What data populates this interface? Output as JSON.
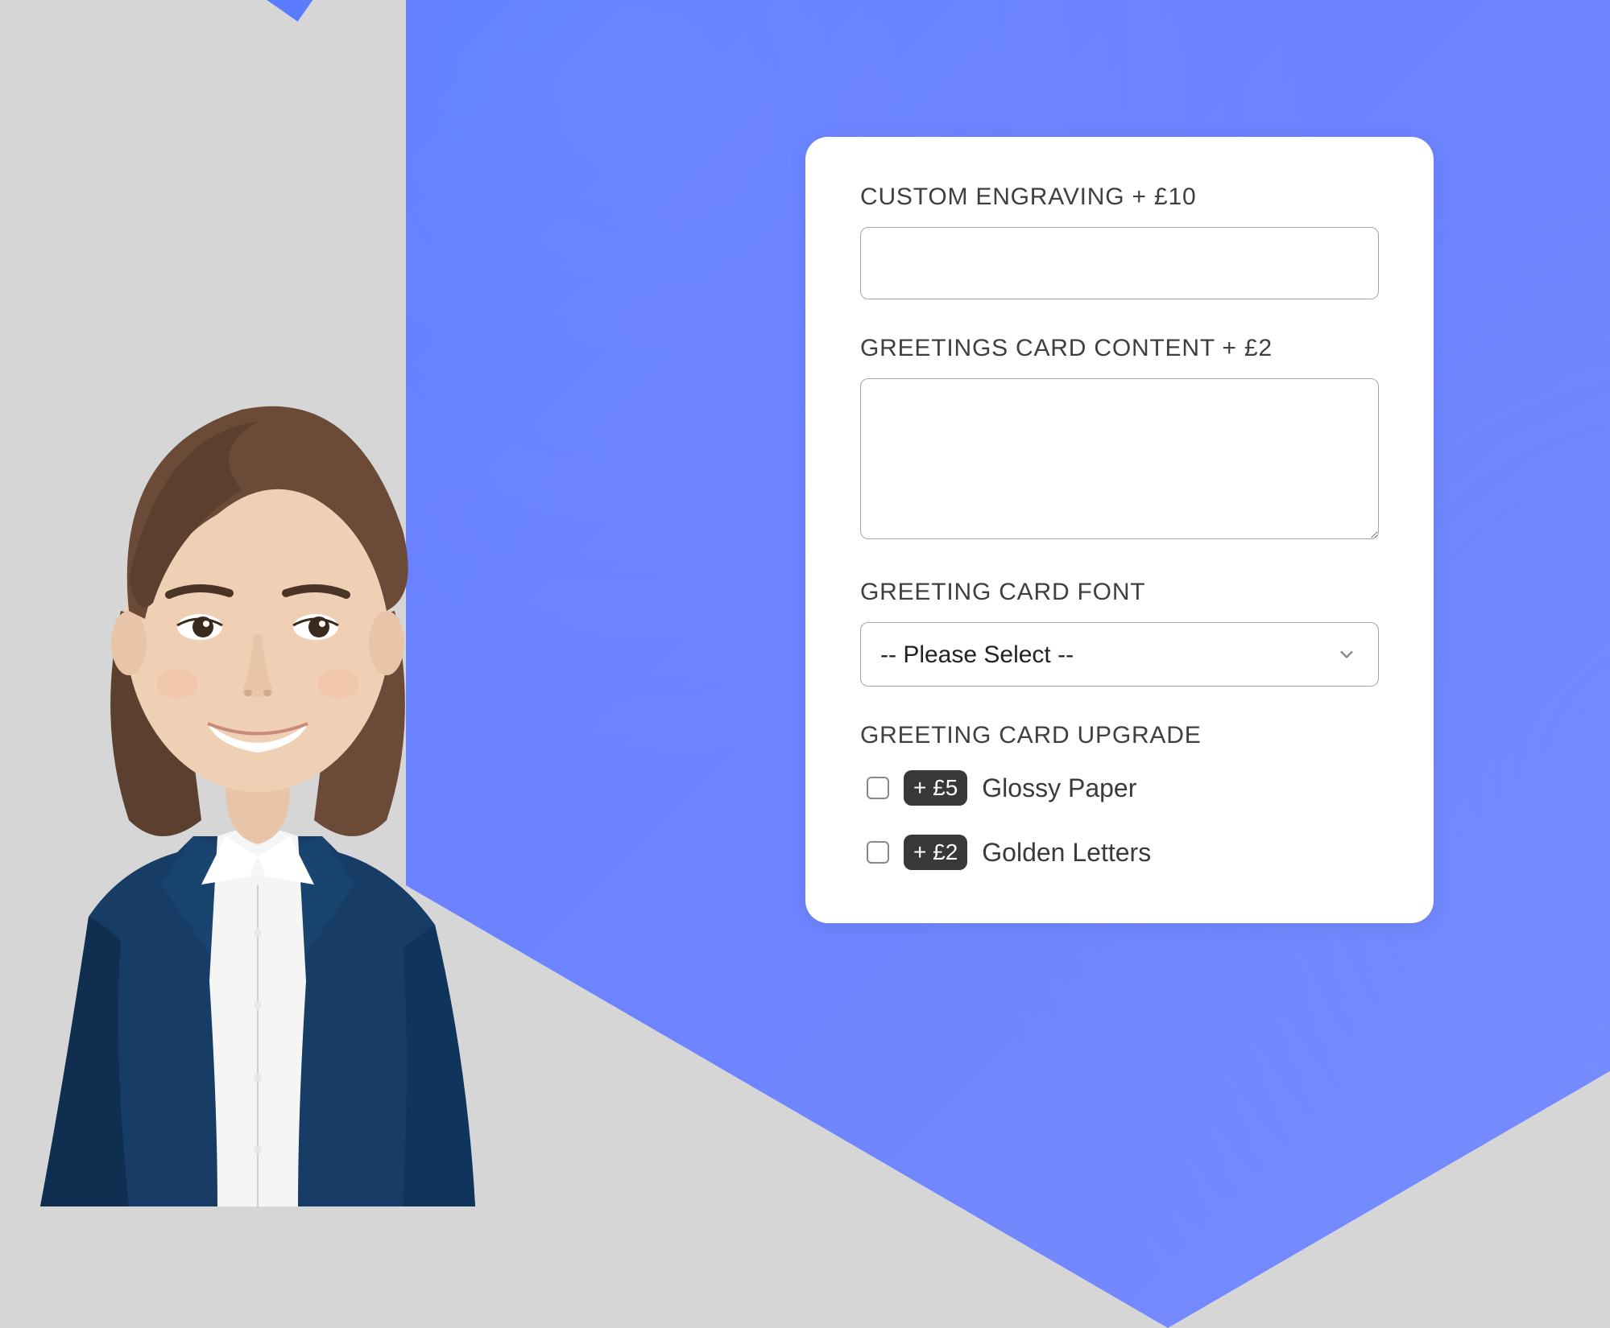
{
  "form": {
    "engraving": {
      "label": "CUSTOM ENGRAVING + £10",
      "value": ""
    },
    "greetings_content": {
      "label": "GREETINGS CARD CONTENT + £2",
      "value": ""
    },
    "font": {
      "label": "GREETING CARD FONT",
      "placeholder": "-- Please Select --"
    },
    "upgrade": {
      "label": "GREETING CARD UPGRADE",
      "options": [
        {
          "price": "+ £5",
          "name": "Glossy Paper"
        },
        {
          "price": "+ £2",
          "name": "Golden Letters"
        }
      ]
    }
  }
}
